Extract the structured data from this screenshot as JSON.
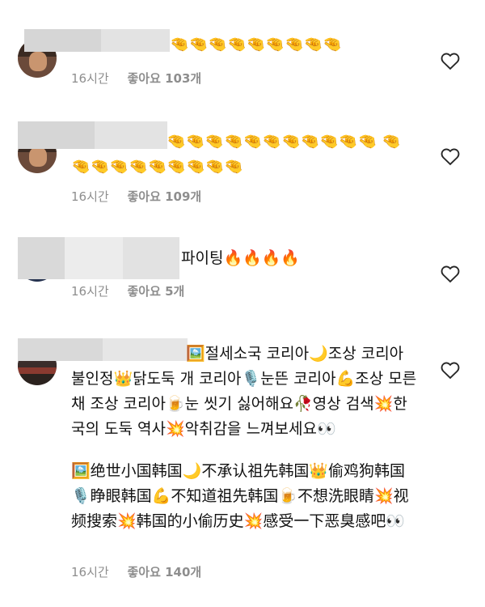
{
  "icons": {
    "heart": "heart-outline-icon",
    "pinch": "pinching-hand",
    "fire": "fire",
    "eyes": "eyes"
  },
  "comments": [
    {
      "text": "🤏🤏🤏🤏🤏🤏🤏🤏🤏",
      "time": "16시간",
      "likes": "좋아요 103개"
    },
    {
      "text": "🤏🤏🤏🤏🤏🤏🤏🤏🤏🤏🤏 🤏🤏🤏🤏🤏🤏🤏🤏🤏🤏",
      "time": "16시간",
      "likes": "좋아요 109개"
    },
    {
      "text": "파이팅🔥🔥🔥🔥",
      "time": "16시간",
      "likes": "좋아요 5개"
    },
    {
      "text_ko": "🖼️절세소국 코리아🌙조상 코리아 불인정👑닭도둑 개 코리아🎙️눈뜬 코리아💪조상 모른 채 조상 코리아🍺눈 씻기 싫어해요🥀영상 검색💥한국의 도둑 역사💥악취감을 느껴보세요👀",
      "text_zh": "🖼️绝世小国韩国🌙不承认祖先韩国👑偷鸡狗韩国🎙️睁眼韩国💪不知道祖先韩国🍺不想洗眼睛💥视频搜索💥韩国的小偷历史💥感受一下恶臭感吧👀",
      "time": "16시간",
      "likes": "좋아요 140개"
    }
  ]
}
